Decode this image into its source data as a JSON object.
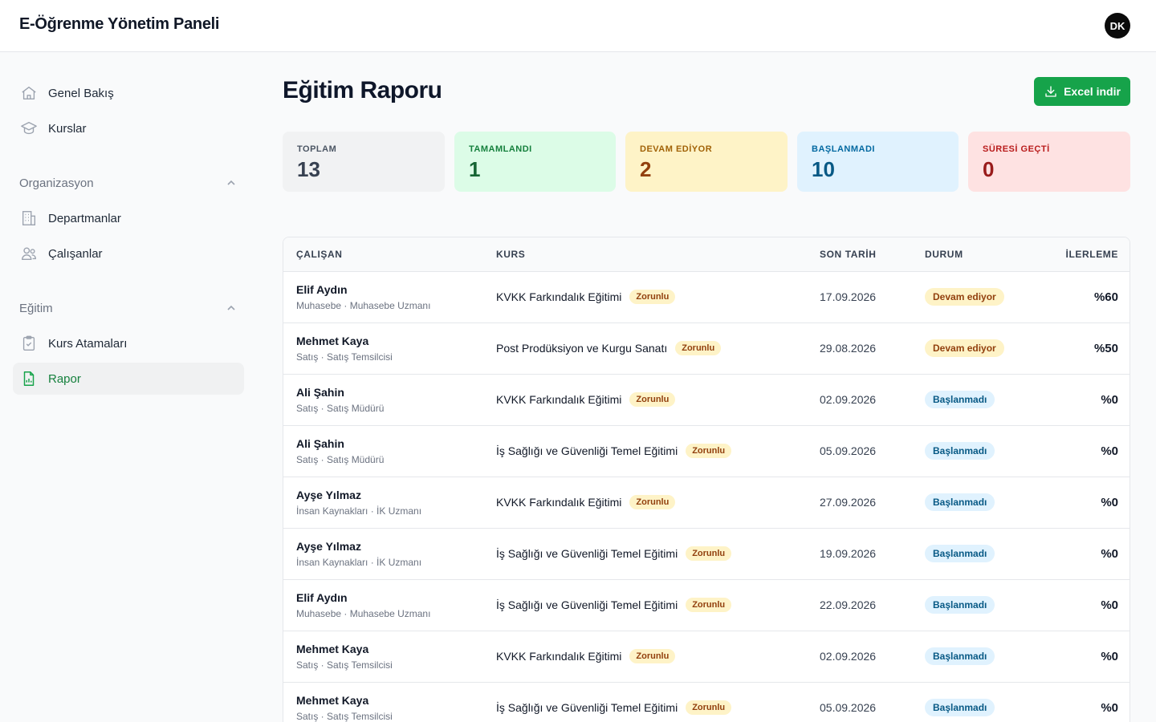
{
  "app": {
    "title": "E-Öğrenme Yönetim Paneli",
    "avatar_initials": "DK"
  },
  "sidebar": {
    "top_items": [
      {
        "label": "Genel Bakış",
        "icon": "home-icon"
      },
      {
        "label": "Kurslar",
        "icon": "graduation-cap-icon"
      }
    ],
    "sections": [
      {
        "label": "Organizasyon",
        "expanded": true,
        "items": [
          {
            "label": "Departmanlar",
            "icon": "building-icon"
          },
          {
            "label": "Çalışanlar",
            "icon": "users-icon"
          }
        ]
      },
      {
        "label": "Eğitim",
        "expanded": true,
        "items": [
          {
            "label": "Kurs Atamaları",
            "icon": "clipboard-check-icon"
          },
          {
            "label": "Rapor",
            "icon": "file-chart-icon",
            "active": true
          }
        ]
      }
    ]
  },
  "page": {
    "title": "Eğitim Raporu",
    "export_button": "Excel indir"
  },
  "stats": [
    {
      "label": "TOPLAM",
      "value": "13",
      "bg": "#f1f2f3",
      "fg": "#374151",
      "lc": "#4b5563"
    },
    {
      "label": "TAMAMLANDI",
      "value": "1",
      "bg": "#dcfce7",
      "fg": "#166534",
      "lc": "#15803d"
    },
    {
      "label": "DEVAM EDİYOR",
      "value": "2",
      "bg": "#fef3c7",
      "fg": "#92400e",
      "lc": "#a16207"
    },
    {
      "label": "BAŞLANMADI",
      "value": "10",
      "bg": "#e0f2fe",
      "fg": "#075985",
      "lc": "#0369a1"
    },
    {
      "label": "SÜRESİ GEÇTİ",
      "value": "0",
      "bg": "#fee2e2",
      "fg": "#991b1b",
      "lc": "#b91c1c"
    }
  ],
  "table": {
    "headers": {
      "employee": "ÇALIŞAN",
      "course": "KURS",
      "due": "SON TARİH",
      "status": "DURUM",
      "progress": "İLERLEME"
    },
    "rows": [
      {
        "name": "Elif Aydın",
        "sub": "Muhasebe · Muhasebe Uzmanı",
        "course": "KVKK Farkındalık Eğitimi",
        "tag": "Zorunlu",
        "due": "17.09.2026",
        "status": "Devam ediyor",
        "status_kind": "progress",
        "progress": "%60"
      },
      {
        "name": "Mehmet Kaya",
        "sub": "Satış · Satış Temsilcisi",
        "course": "Post Prodüksiyon ve Kurgu Sanatı",
        "tag": "Zorunlu",
        "due": "29.08.2026",
        "status": "Devam ediyor",
        "status_kind": "progress",
        "progress": "%50"
      },
      {
        "name": "Ali Şahin",
        "sub": "Satış · Satış Müdürü",
        "course": "KVKK Farkındalık Eğitimi",
        "tag": "Zorunlu",
        "due": "02.09.2026",
        "status": "Başlanmadı",
        "status_kind": "notstarted",
        "progress": "%0"
      },
      {
        "name": "Ali Şahin",
        "sub": "Satış · Satış Müdürü",
        "course": "İş Sağlığı ve Güvenliği Temel Eğitimi",
        "tag": "Zorunlu",
        "due": "05.09.2026",
        "status": "Başlanmadı",
        "status_kind": "notstarted",
        "progress": "%0"
      },
      {
        "name": "Ayşe Yılmaz",
        "sub": "İnsan Kaynakları · İK Uzmanı",
        "course": "KVKK Farkındalık Eğitimi",
        "tag": "Zorunlu",
        "due": "27.09.2026",
        "status": "Başlanmadı",
        "status_kind": "notstarted",
        "progress": "%0"
      },
      {
        "name": "Ayşe Yılmaz",
        "sub": "İnsan Kaynakları · İK Uzmanı",
        "course": "İş Sağlığı ve Güvenliği Temel Eğitimi",
        "tag": "Zorunlu",
        "due": "19.09.2026",
        "status": "Başlanmadı",
        "status_kind": "notstarted",
        "progress": "%0"
      },
      {
        "name": "Elif Aydın",
        "sub": "Muhasebe · Muhasebe Uzmanı",
        "course": "İş Sağlığı ve Güvenliği Temel Eğitimi",
        "tag": "Zorunlu",
        "due": "22.09.2026",
        "status": "Başlanmadı",
        "status_kind": "notstarted",
        "progress": "%0"
      },
      {
        "name": "Mehmet Kaya",
        "sub": "Satış · Satış Temsilcisi",
        "course": "KVKK Farkındalık Eğitimi",
        "tag": "Zorunlu",
        "due": "02.09.2026",
        "status": "Başlanmadı",
        "status_kind": "notstarted",
        "progress": "%0"
      },
      {
        "name": "Mehmet Kaya",
        "sub": "Satış · Satış Temsilcisi",
        "course": "İş Sağlığı ve Güvenliği Temel Eğitimi",
        "tag": "Zorunlu",
        "due": "05.09.2026",
        "status": "Başlanmadı",
        "status_kind": "notstarted",
        "progress": "%0"
      }
    ]
  }
}
